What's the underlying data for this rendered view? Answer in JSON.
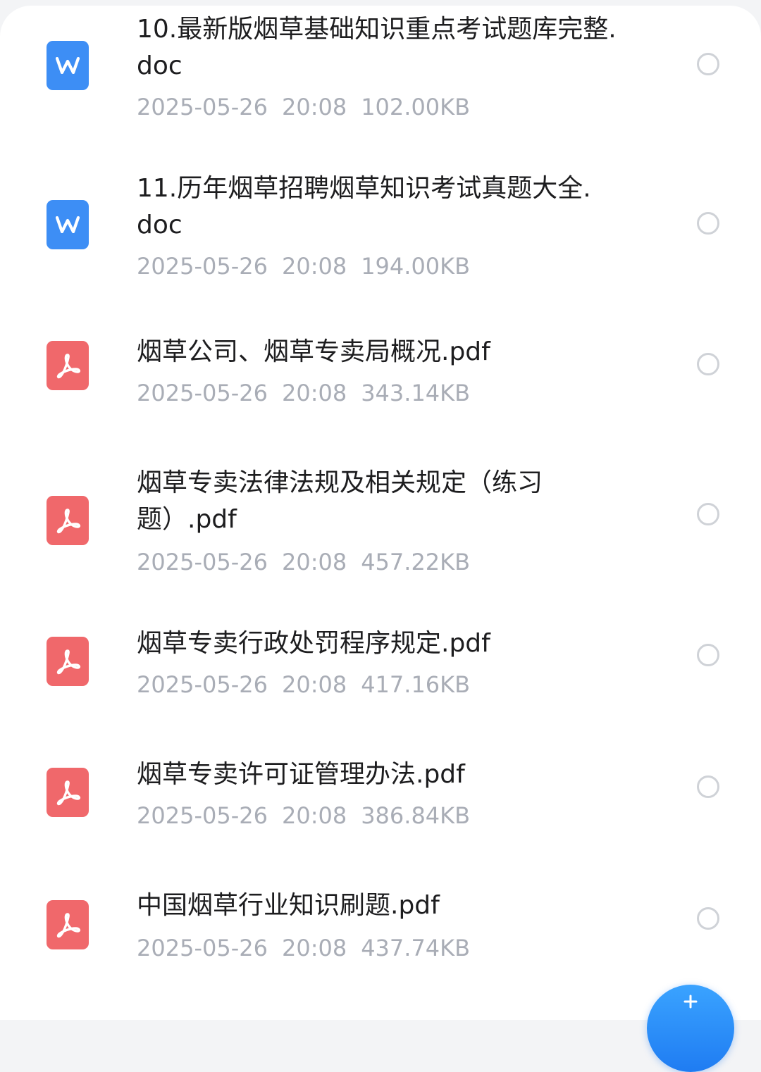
{
  "files": [
    {
      "type": "doc",
      "name": "10.最新版烟草基础知识重点考试题库完整.doc",
      "date": "2025-05-26",
      "time": "20:08",
      "size": "102.00KB",
      "selected": false
    },
    {
      "type": "doc",
      "name": "11.历年烟草招聘烟草知识考试真题大全.doc",
      "date": "2025-05-26",
      "time": "20:08",
      "size": "194.00KB",
      "selected": false
    },
    {
      "type": "pdf",
      "name": "烟草公司、烟草专卖局概况.pdf",
      "date": "2025-05-26",
      "time": "20:08",
      "size": "343.14KB",
      "selected": false
    },
    {
      "type": "pdf",
      "name": "烟草专卖法律法规及相关规定（练习题）.pdf",
      "date": "2025-05-26",
      "time": "20:08",
      "size": "457.22KB",
      "selected": false
    },
    {
      "type": "pdf",
      "name": "烟草专卖行政处罚程序规定.pdf",
      "date": "2025-05-26",
      "time": "20:08",
      "size": "417.16KB",
      "selected": false
    },
    {
      "type": "pdf",
      "name": "烟草专卖许可证管理办法.pdf",
      "date": "2025-05-26",
      "time": "20:08",
      "size": "386.84KB",
      "selected": false
    },
    {
      "type": "pdf",
      "name": "中国烟草行业知识刷题.pdf",
      "date": "2025-05-26",
      "time": "20:08",
      "size": "437.74KB",
      "selected": false
    }
  ],
  "icons": {
    "doc": "word-doc-icon",
    "pdf": "pdf-icon",
    "fab": "plus-icon"
  },
  "colors": {
    "doc_icon": "#3d8ef5",
    "pdf_icon": "#f0686b",
    "accent": "#1f7cf2",
    "meta_text": "#a9adb6"
  }
}
